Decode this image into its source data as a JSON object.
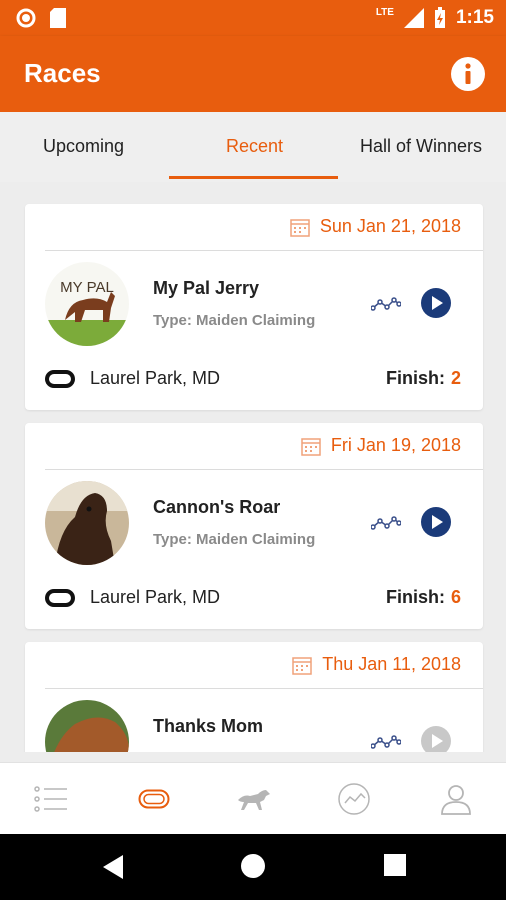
{
  "status_bar": {
    "lte": "LTE",
    "time": "1:15"
  },
  "app_bar": {
    "title": "Races"
  },
  "tabs": [
    {
      "label": "Upcoming"
    },
    {
      "label": "Recent"
    },
    {
      "label": "Hall of Winners"
    }
  ],
  "races": [
    {
      "date": "Sun Jan 21, 2018",
      "horse": "My Pal Jerry",
      "type": "Type: Maiden Claiming",
      "track": "Laurel Park, MD",
      "finish_label": "Finish:",
      "finish": "2",
      "avatar_text": "MY PAL"
    },
    {
      "date": "Fri Jan 19, 2018",
      "horse": "Cannon's Roar",
      "type": "Type: Maiden Claiming",
      "track": "Laurel Park, MD",
      "finish_label": "Finish:",
      "finish": "6"
    },
    {
      "date": "Thu Jan 11, 2018",
      "horse": "Thanks Mom"
    }
  ],
  "bottom_nav": [
    {
      "icon": "list-icon"
    },
    {
      "icon": "track-icon"
    },
    {
      "icon": "horse-icon"
    },
    {
      "icon": "stats-icon"
    },
    {
      "icon": "profile-icon"
    }
  ],
  "colors": {
    "accent": "#e85d0e",
    "play": "#1b3b7a"
  }
}
